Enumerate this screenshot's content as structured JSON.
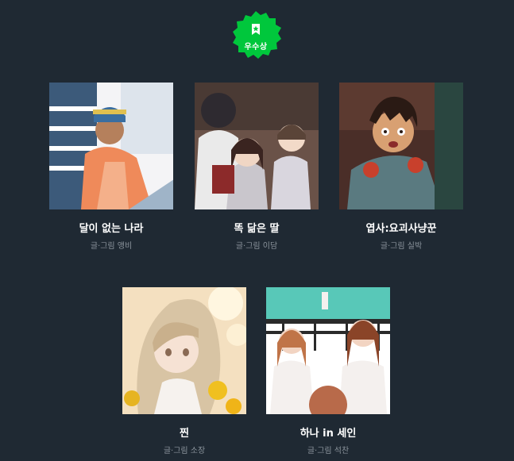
{
  "award": {
    "label": "우수상",
    "icon": "ribbon-icon",
    "color": "#00c73c"
  },
  "works": [
    {
      "title": "달이 없는 나라",
      "author": "글·그림 앵비"
    },
    {
      "title": "똑 닮은 딸",
      "author": "글·그림 이담"
    },
    {
      "title": "엽사:요괴사냥꾼",
      "author": "글·그림 실박"
    },
    {
      "title": "찐",
      "author": "글·그림 소장"
    },
    {
      "title": "하나 in 세인",
      "author": "글·그림 석찬"
    }
  ]
}
